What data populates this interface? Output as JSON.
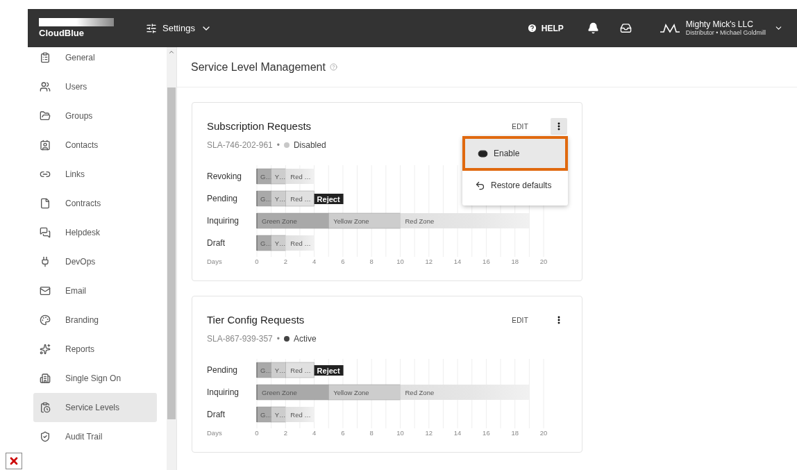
{
  "header": {
    "logo": "CloudBlue",
    "menu": "Settings",
    "help": "HELP",
    "account": {
      "name": "Mighty Mick's LLC",
      "subtitle": "Distributor • Michael Goldmill"
    }
  },
  "sidebar": {
    "items": [
      {
        "label": "General",
        "selected": false
      },
      {
        "label": "Users",
        "selected": false
      },
      {
        "label": "Groups",
        "selected": false
      },
      {
        "label": "Contacts",
        "selected": false
      },
      {
        "label": "Links",
        "selected": false
      },
      {
        "label": "Contracts",
        "selected": false
      },
      {
        "label": "Helpdesk",
        "selected": false
      },
      {
        "label": "DevOps",
        "selected": false
      },
      {
        "label": "Email",
        "selected": false
      },
      {
        "label": "Branding",
        "selected": false
      },
      {
        "label": "Reports",
        "selected": false
      },
      {
        "label": "Single Sign On",
        "selected": false
      },
      {
        "label": "Service Levels",
        "selected": true
      },
      {
        "label": "Audit Trail",
        "selected": false
      }
    ]
  },
  "page": {
    "title": "Service Level Management"
  },
  "cards": [
    {
      "title": "Subscription Requests",
      "id": "SLA-746-202-961",
      "separator": "•",
      "status": "Disabled",
      "active": false,
      "edit": "EDIT",
      "menu_open": true,
      "menu": [
        {
          "label": "Enable",
          "kind": "toggle",
          "selected": true
        },
        {
          "label": "Restore defaults",
          "kind": "restore",
          "selected": false
        }
      ],
      "chart_data": {
        "type": "bar",
        "orientation": "horizontal",
        "stacked": true,
        "grid": true,
        "xlabel": "Days",
        "categories": [
          "Revoking",
          "Pending",
          "Inquiring",
          "Draft"
        ],
        "xlim": [
          0,
          20
        ],
        "series": [
          {
            "name": "Green Zone",
            "color": "#a9a9a9",
            "values": [
              1,
              1,
              5,
              1
            ]
          },
          {
            "name": "Yellow Zone",
            "color": "#cdcdcd",
            "values": [
              1,
              1,
              5,
              1
            ]
          },
          {
            "name": "Red Zone",
            "color": "#e0e0e0",
            "values": [
              2,
              2,
              9,
              2
            ]
          }
        ],
        "xticks": [
          0,
          2,
          4,
          6,
          8,
          10,
          12,
          14,
          16,
          18,
          20
        ],
        "annotations": [
          {
            "x": 0,
            "y": "Revoking",
            "text": "G…"
          },
          {
            "x": 1,
            "y": "Revoking",
            "text": "Y…"
          },
          {
            "x": 2,
            "y": "Revoking",
            "text": "Red …"
          },
          {
            "x": 0,
            "y": "Pending",
            "text": "G…"
          },
          {
            "x": 1,
            "y": "Pending",
            "text": "Y…"
          },
          {
            "x": 2,
            "y": "Pending",
            "text": "Red …"
          },
          {
            "x": 4,
            "y": "Pending",
            "text": "Reject"
          },
          {
            "x": 0,
            "y": "Draft",
            "text": "G…"
          },
          {
            "x": 1,
            "y": "Draft",
            "text": "Y…"
          },
          {
            "x": 2,
            "y": "Draft",
            "text": "Red …"
          }
        ]
      }
    },
    {
      "title": "Tier Config Requests",
      "id": "SLA-867-939-357",
      "separator": "•",
      "status": "Active",
      "active": true,
      "edit": "EDIT",
      "menu_open": false,
      "chart_data": {
        "type": "bar",
        "orientation": "horizontal",
        "stacked": true,
        "grid": true,
        "xlabel": "Days",
        "categories": [
          "Pending",
          "Inquiring",
          "Draft"
        ],
        "xlim": [
          0,
          20
        ],
        "series": [
          {
            "name": "Green Zone",
            "color": "#a9a9a9",
            "values": [
              1,
              5,
              1
            ]
          },
          {
            "name": "Yellow Zone",
            "color": "#cdcdcd",
            "values": [
              1,
              5,
              1
            ]
          },
          {
            "name": "Red Zone",
            "color": "#e0e0e0",
            "values": [
              2,
              9,
              2
            ]
          }
        ],
        "xticks": [
          0,
          2,
          4,
          6,
          8,
          10,
          12,
          14,
          16,
          18,
          20
        ],
        "annotations": [
          {
            "x": 0,
            "y": "Pending",
            "text": "G…"
          },
          {
            "x": 1,
            "y": "Pending",
            "text": "Y…"
          },
          {
            "x": 2,
            "y": "Pending",
            "text": "Red …"
          },
          {
            "x": 4,
            "y": "Pending",
            "text": "Reject"
          },
          {
            "x": 0,
            "y": "Draft",
            "text": "G…"
          },
          {
            "x": 1,
            "y": "Draft",
            "text": "Y…"
          },
          {
            "x": 2,
            "y": "Draft",
            "text": "Red …"
          }
        ]
      }
    }
  ]
}
